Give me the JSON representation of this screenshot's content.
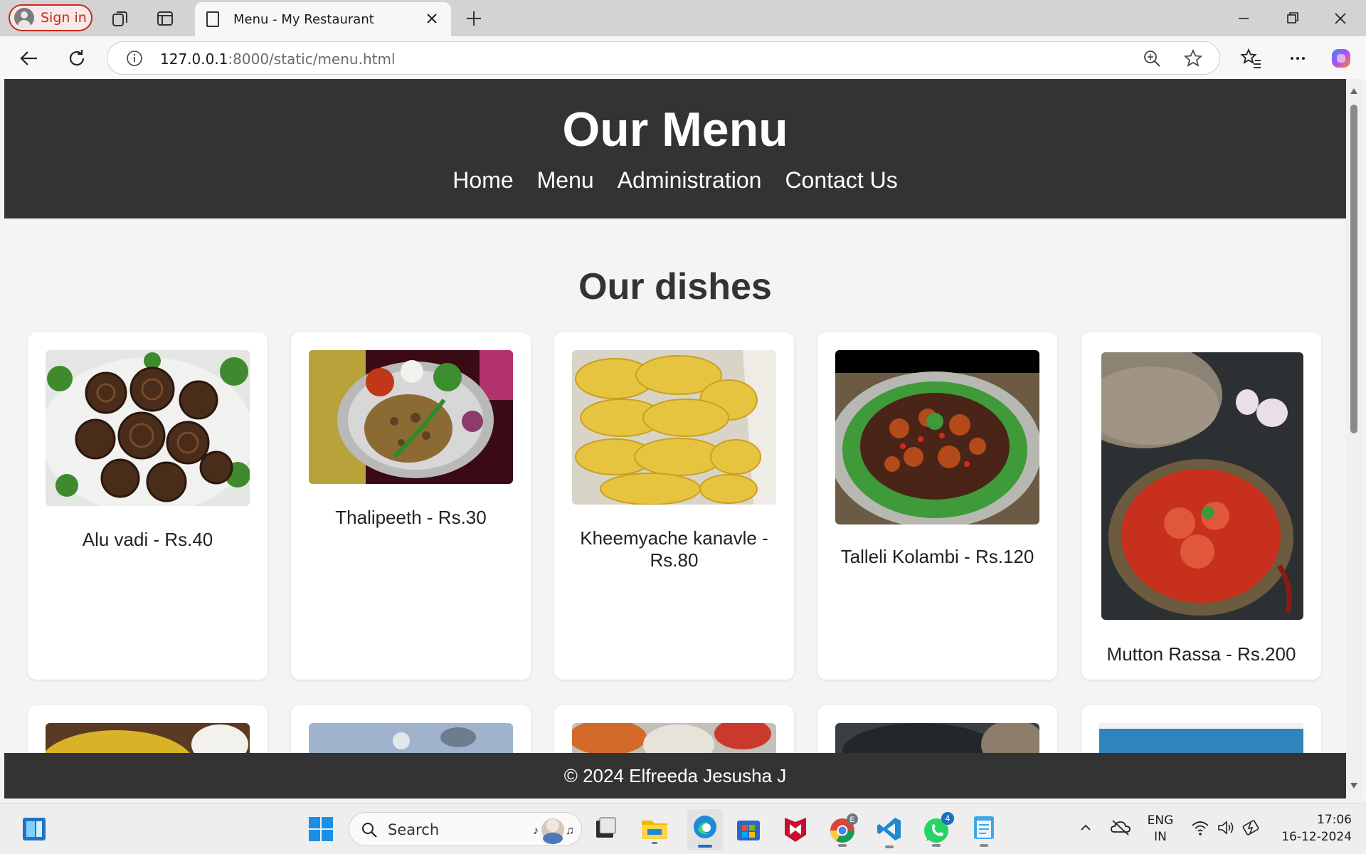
{
  "browser": {
    "signin_label": "Sign in",
    "tab_title": "Menu - My Restaurant",
    "url_host": "127.0.0.1",
    "url_rest": ":8000/static/menu.html"
  },
  "page": {
    "title": "Our Menu",
    "nav": [
      "Home",
      "Menu",
      "Administration",
      "Contact Us"
    ],
    "section_heading": "Our dishes",
    "dishes": [
      "Alu vadi - Rs.40",
      "Thalipeeth - Rs.30",
      "Kheemyache kanavle -",
      "Rs.80",
      "Talleli Kolambi - Rs.120",
      "Mutton Rassa - Rs.200"
    ],
    "footer": "© 2024 Elfreeda Jesusha J"
  },
  "taskbar": {
    "search_label": "Search",
    "lang_top": "ENG",
    "lang_bottom": "IN",
    "time": "17:06",
    "date": "16-12-2024",
    "whatsapp_badge": "4",
    "chrome_badge": "E"
  },
  "colors": {
    "header_bg": "#333333",
    "page_bg": "#f4f4f4",
    "signin_accent": "#c42b1c"
  }
}
